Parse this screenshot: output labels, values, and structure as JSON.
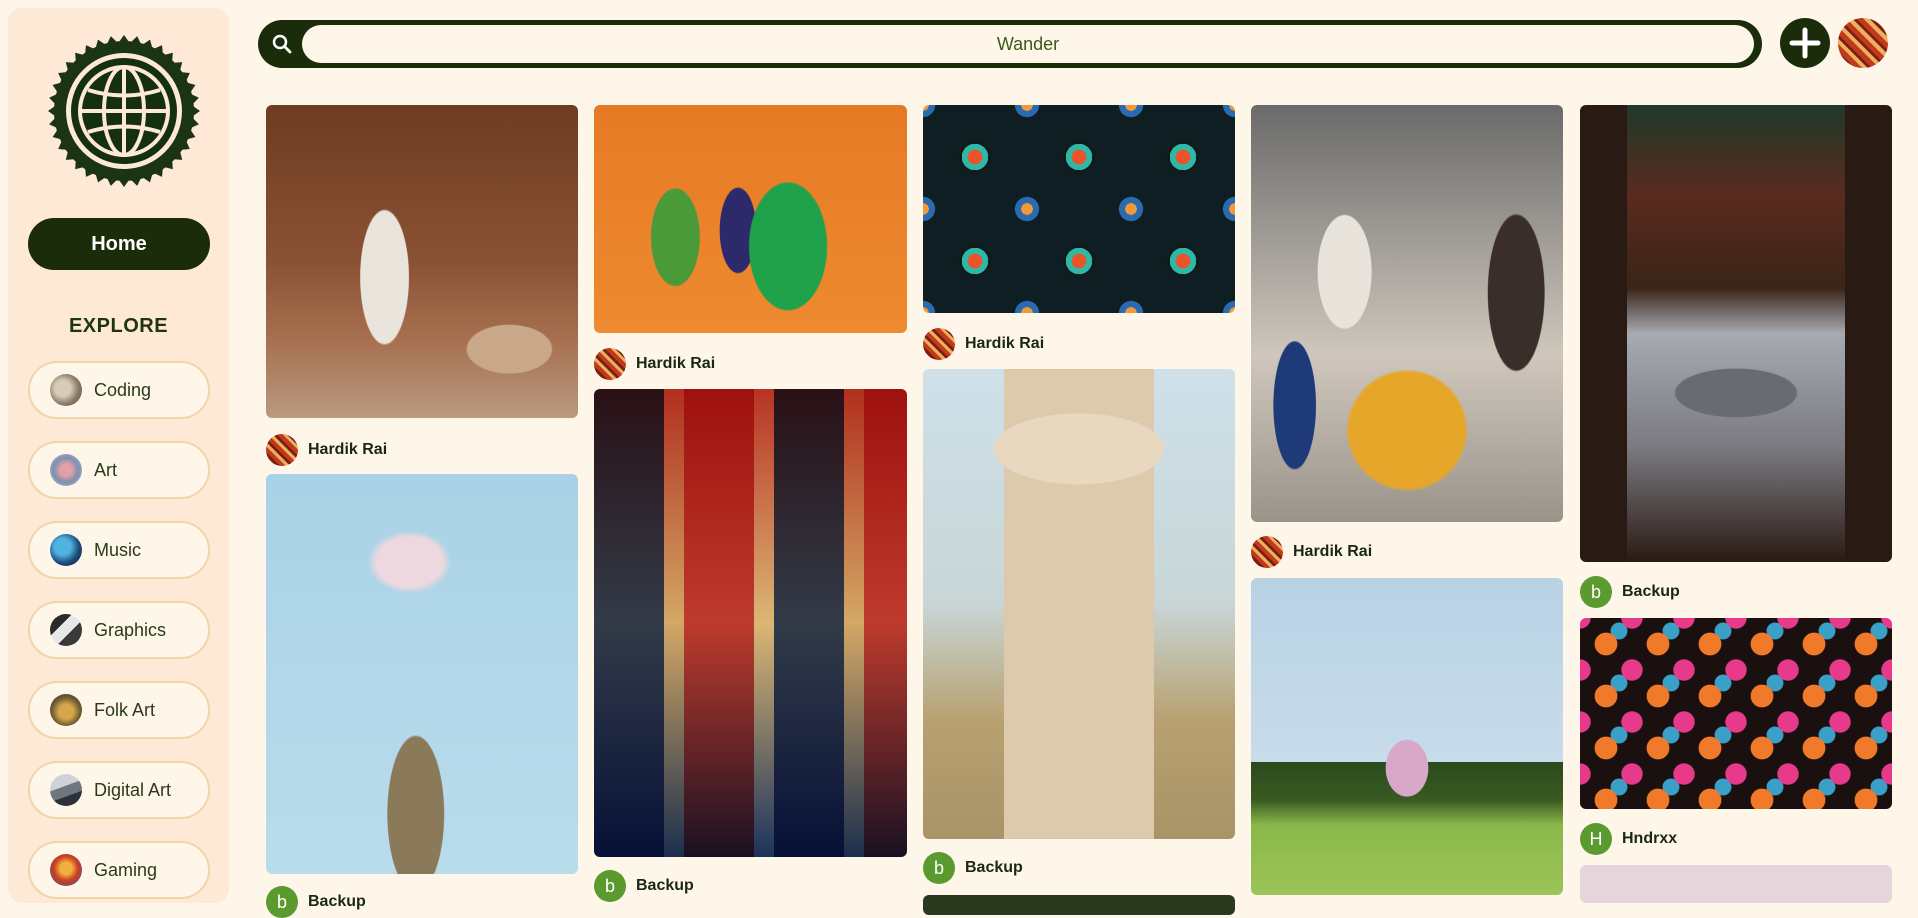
{
  "sidebar": {
    "home_label": "Home",
    "explore_title": "EXPLORE",
    "categories": [
      {
        "label": "Coding"
      },
      {
        "label": "Art"
      },
      {
        "label": "Music"
      },
      {
        "label": "Graphics"
      },
      {
        "label": "Folk Art"
      },
      {
        "label": "Digital Art"
      },
      {
        "label": "Gaming"
      }
    ]
  },
  "search": {
    "value": "Wander"
  },
  "pins": [
    {
      "author": "Hardik Rai",
      "avatar": "image"
    },
    {
      "author": "Backup",
      "avatar_letter": "b"
    },
    {
      "author": "Hardik Rai",
      "avatar": "image"
    },
    {
      "author": "Backup",
      "avatar_letter": "b"
    },
    {
      "author": "Hardik Rai",
      "avatar": "image"
    },
    {
      "author": "Backup",
      "avatar_letter": "b"
    },
    {
      "author": "Hardik Rai",
      "avatar": "image"
    },
    {
      "author": "Backup",
      "avatar_letter": "b"
    },
    {
      "author": "Hndrxx",
      "avatar_letter": "H"
    }
  ],
  "colors": {
    "page_bg": "#fff6ea",
    "sidebar_bg": "#fde9d5",
    "accent_dark": "#1a2c0a",
    "letter_avatar": "#5a9a2e"
  },
  "icons": {
    "logo": "globe-icon",
    "search": "search-icon",
    "add": "plus-icon"
  }
}
